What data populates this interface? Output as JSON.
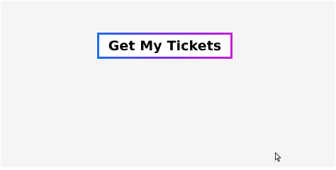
{
  "button": {
    "label": "Get My Tickets"
  },
  "colors": {
    "page_background": "#f5f5f5",
    "button_background": "#ffffff",
    "button_border_gradient_start": "#1e6ee8",
    "button_border_gradient_end": "#c61bd9",
    "button_text": "#000000"
  },
  "cursor": {
    "icon": "mouse-pointer-icon"
  }
}
